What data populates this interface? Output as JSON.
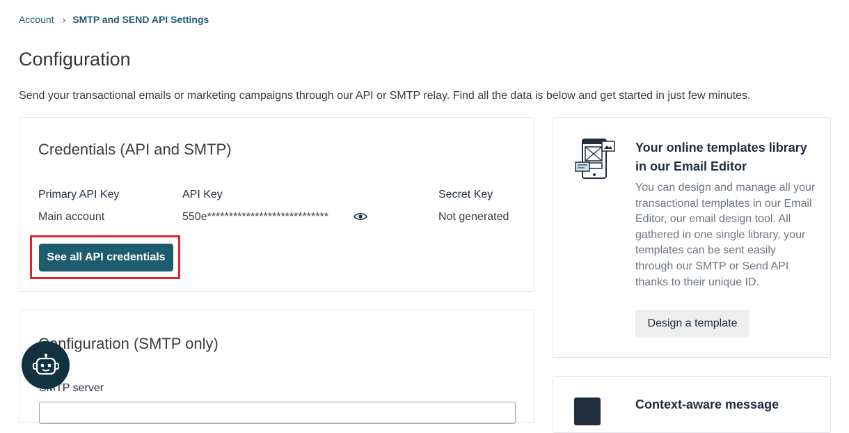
{
  "breadcrumb": {
    "parent": "Account",
    "separator": "›",
    "current": "SMTP and SEND API Settings"
  },
  "page": {
    "title": "Configuration",
    "intro": "Send your transactional emails or marketing campaigns through our API or SMTP relay. Find all the data is below and get started in just few minutes."
  },
  "credentials": {
    "title": "Credentials (API and SMTP)",
    "columns": {
      "primary": "Primary API Key",
      "api": "API Key",
      "secret": "Secret Key"
    },
    "row": {
      "primary": "Main account",
      "api": "550e****************************",
      "secret": "Not generated"
    },
    "button_label": "See all API credentials",
    "icon": "eye-icon",
    "highlight_color": "#e0242e"
  },
  "smtp": {
    "title": "Configuration (SMTP only)",
    "server_label": "SMTP server"
  },
  "templates": {
    "title": "Your online templates library in our Email Editor",
    "description": "You can design and manage all your transactional templates in our Email Editor, our email design tool. All gathered in one single library, your templates can be sent easily through our SMTP or Send API thanks to their unique ID.",
    "button_label": "Design a template",
    "icon": "template-phone-icon"
  },
  "context": {
    "title": "Context-aware message",
    "icon": "phone-icon"
  },
  "chatbot": {
    "icon": "robot-icon"
  },
  "colors": {
    "primary": "#1d5c6e",
    "chat": "#10323f",
    "text": "#1f2d3d"
  }
}
